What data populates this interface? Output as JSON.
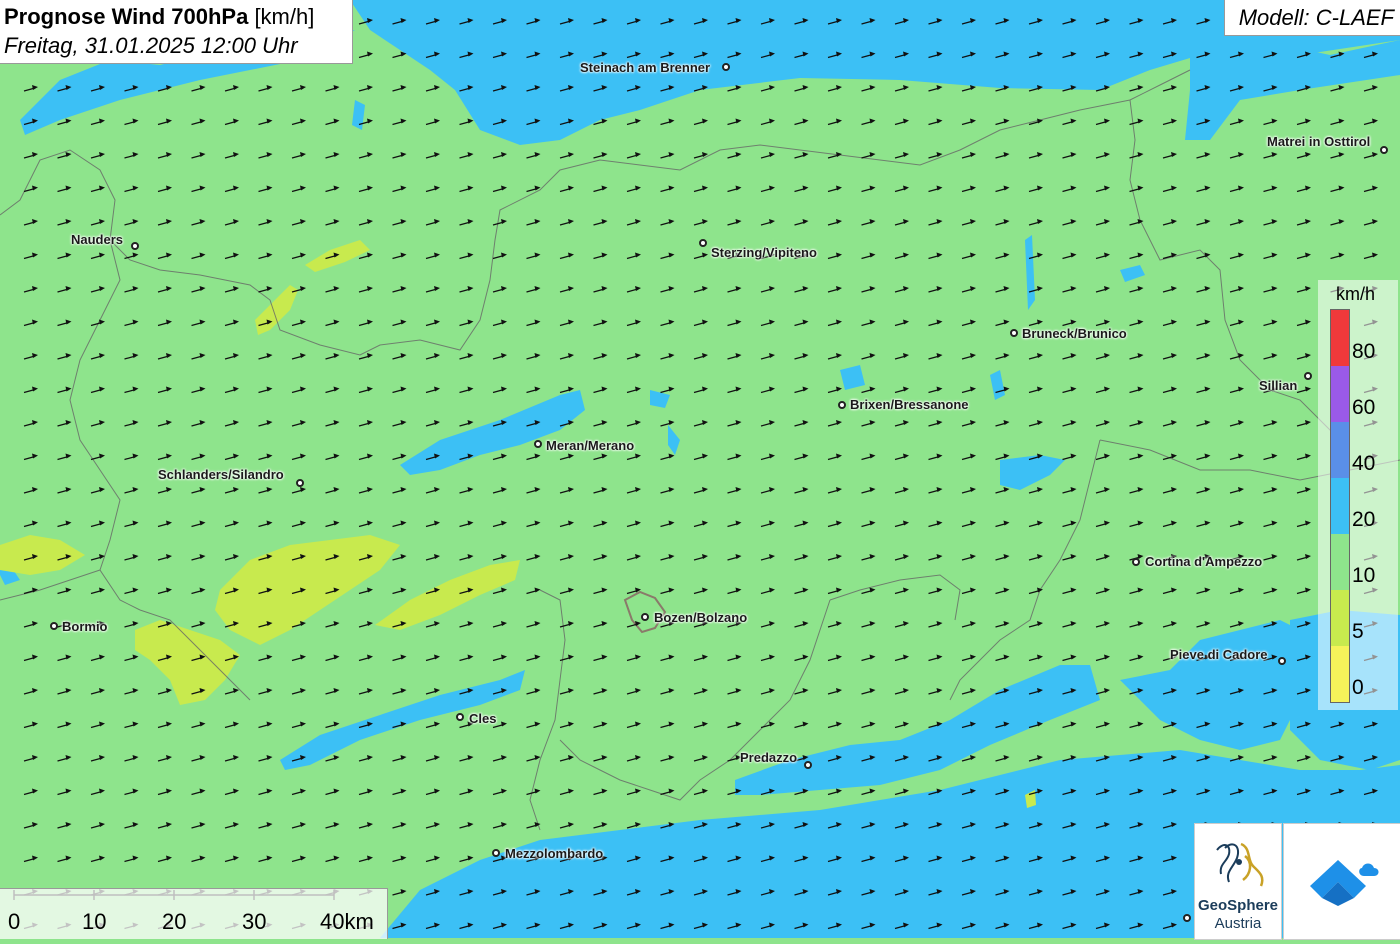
{
  "title": {
    "main_bold": "Prognose Wind 700hPa",
    "main_unit": "[km/h]",
    "date": "Freitag, 31.01.2025 12:00 Uhr"
  },
  "model": "Modell: C-LAEF",
  "legend": {
    "unit": "km/h",
    "labels": [
      "80",
      "60",
      "40",
      "20",
      "10",
      "5",
      "0"
    ],
    "colors": [
      "#f0393b",
      "#9a5ae8",
      "#5a8fe8",
      "#3cc0f5",
      "#8ee48c",
      "#c8ea4e",
      "#f6f35a"
    ]
  },
  "scale_bar": {
    "labels": [
      "0",
      "10",
      "20",
      "30",
      "40km"
    ]
  },
  "logos": {
    "geosphere_line1": "GeoSphere",
    "geosphere_line2": "Austria"
  },
  "cities": [
    {
      "name": "Steinach am Brenner"
    },
    {
      "name": "Matrei in Osttirol"
    },
    {
      "name": "Nauders"
    },
    {
      "name": "Sterzing/Vipiteno"
    },
    {
      "name": "Bruneck/Brunico"
    },
    {
      "name": "Sillian"
    },
    {
      "name": "Brixen/Bressanone"
    },
    {
      "name": "Meran/Merano"
    },
    {
      "name": "Schlanders/Silandro"
    },
    {
      "name": "Cortina d'Ampezzo"
    },
    {
      "name": "Bormio"
    },
    {
      "name": "Bozen/Bolzano"
    },
    {
      "name": "Pieve di Cadore"
    },
    {
      "name": "Cles"
    },
    {
      "name": "Predazzo"
    },
    {
      "name": "Mezzolombardo"
    }
  ],
  "colors": {
    "wind_10_20": "#8ee48c",
    "wind_20_40": "#3cc0f5",
    "wind_5_10": "#c8ea4e"
  }
}
